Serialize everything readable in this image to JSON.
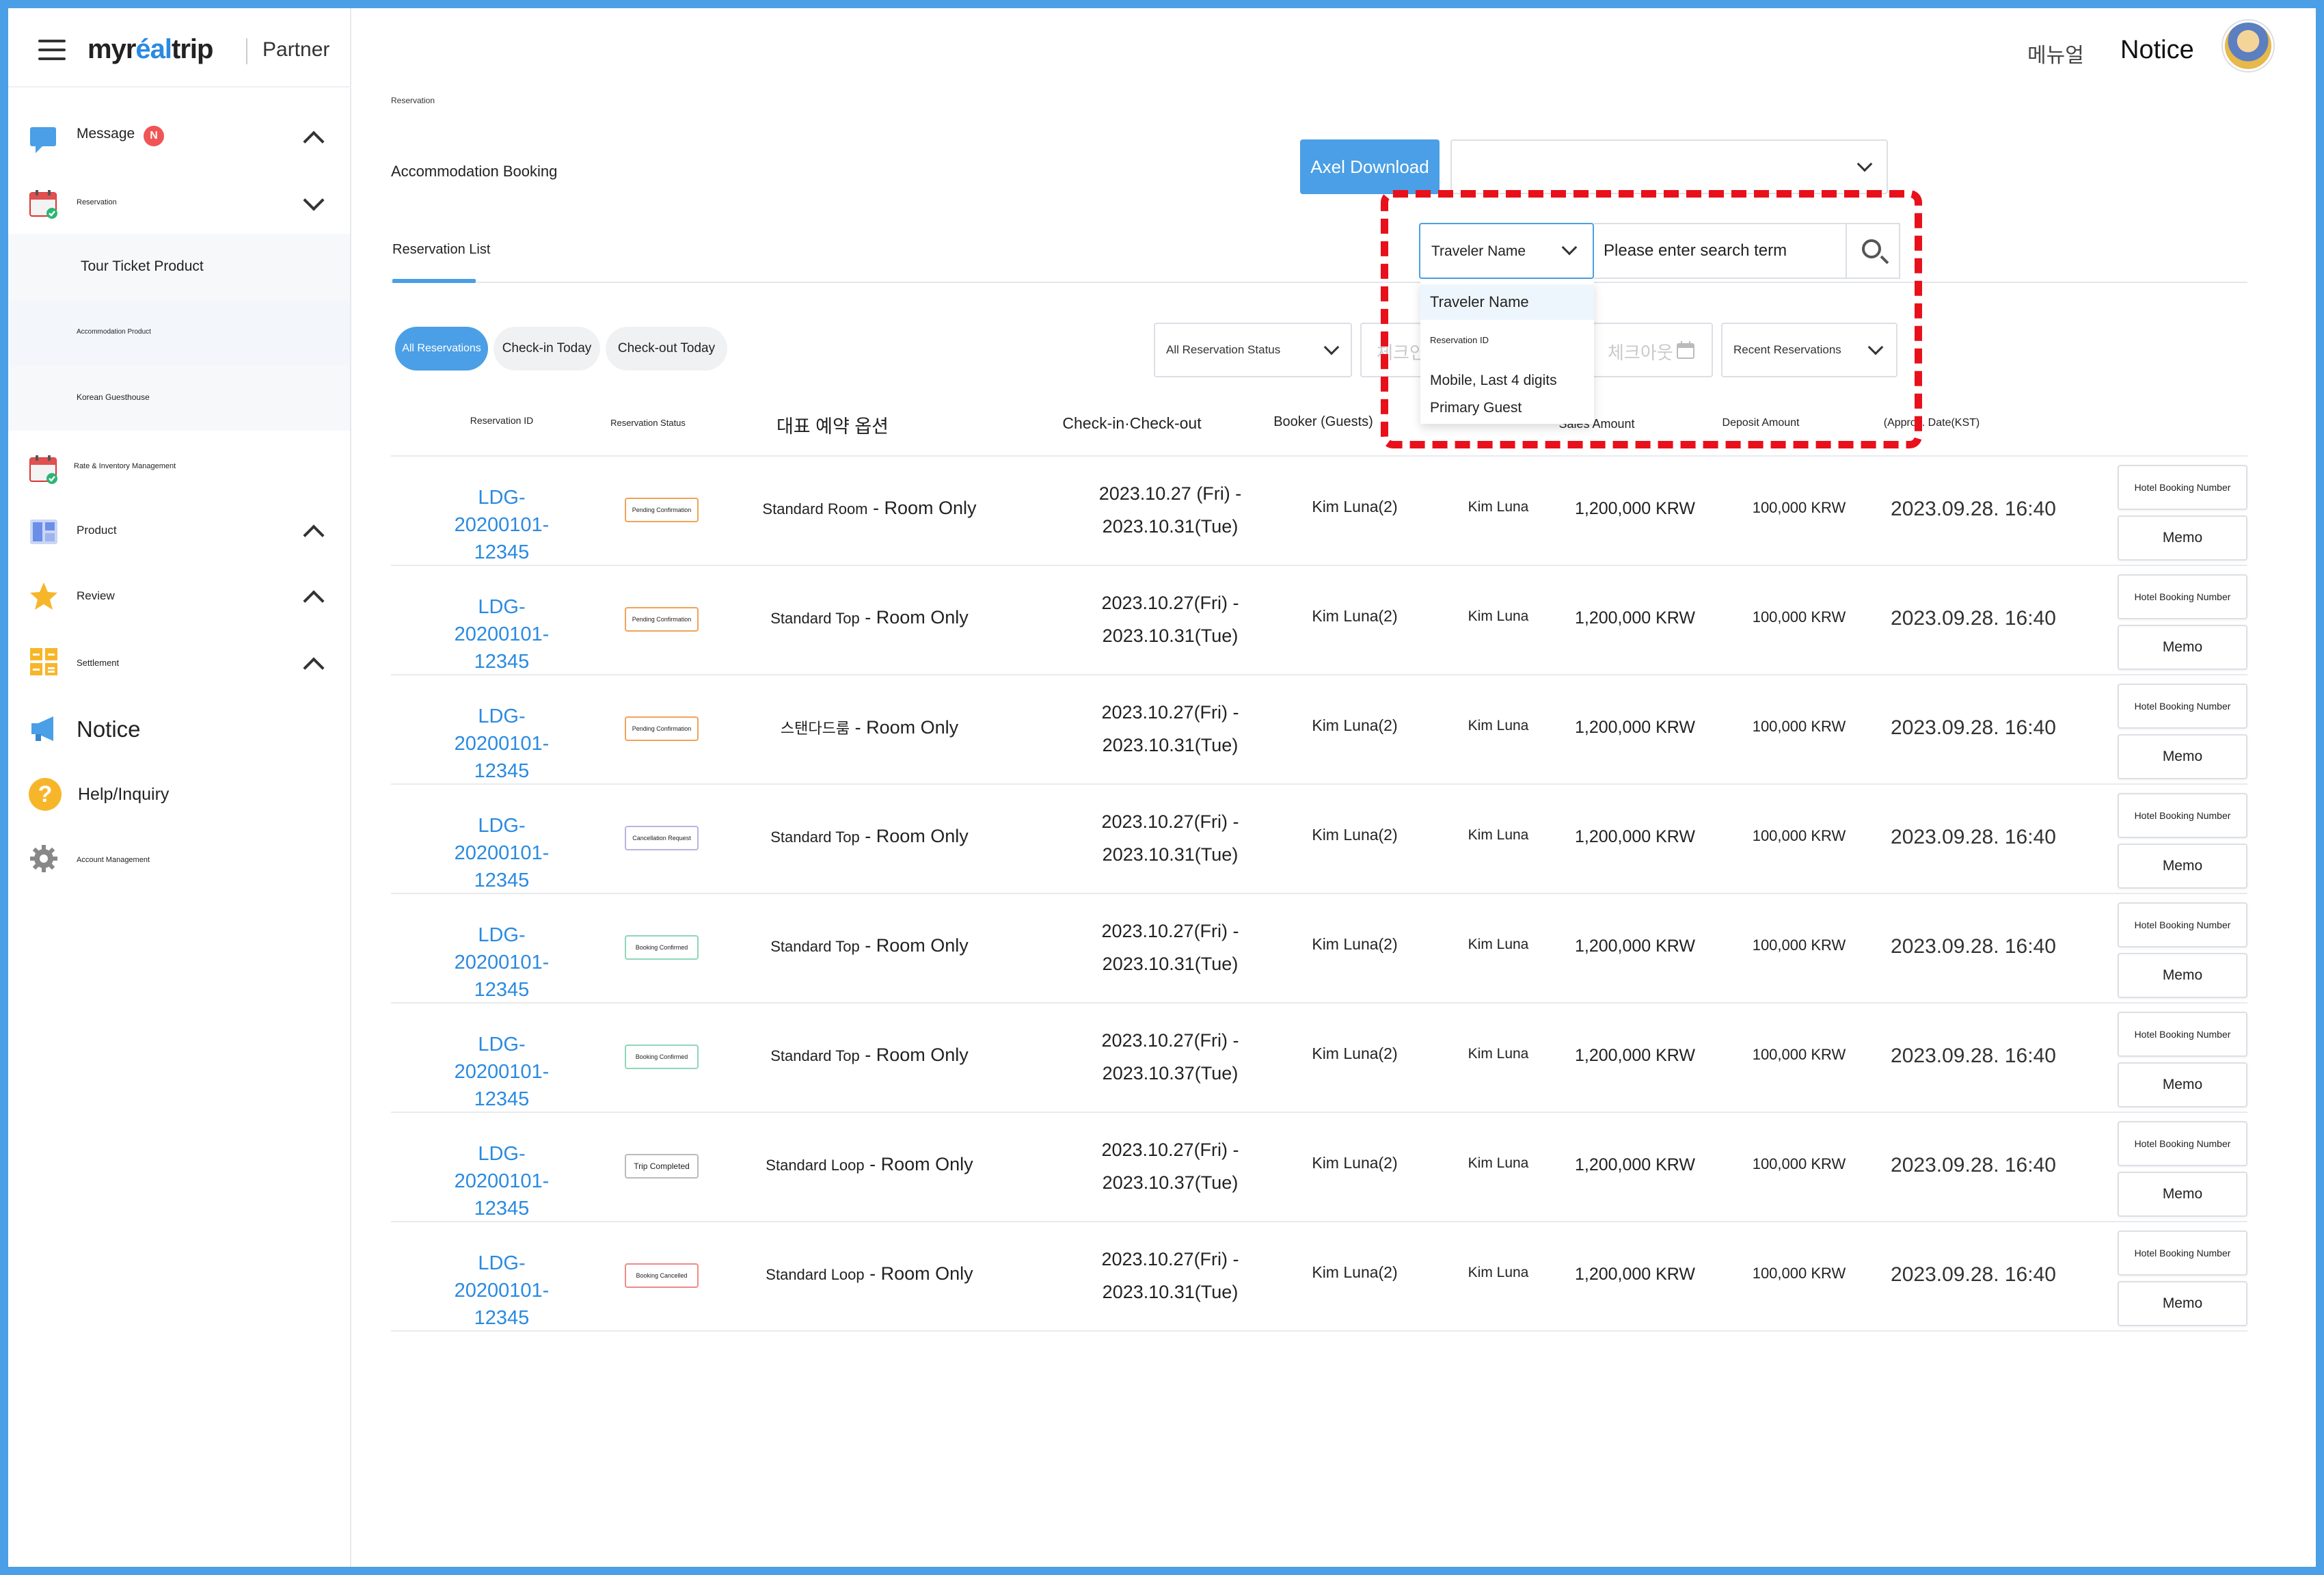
{
  "brand": {
    "logo_pre": "myr",
    "logo_accent": "éal",
    "logo_post": "trip",
    "partner": "Partner",
    "accent_color": "#4a9fe6",
    "alert_color": "#f05454",
    "highlight_color": "#e8101a"
  },
  "topnav": {
    "manual": "메뉴얼",
    "notice": "Notice"
  },
  "sidebar": {
    "message": "Message",
    "message_badge": "N",
    "reservation": "Reservation",
    "sub_tour": "Tour Ticket Product",
    "sub_accommodation": "Accommodation Product",
    "sub_guesthouse": "Korean Guesthouse",
    "rate_inventory": "Rate & Inventory Management",
    "product": "Product",
    "review": "Review",
    "settlement": "Settlement",
    "notice": "Notice",
    "help": "Help/Inquiry",
    "account": "Account Management"
  },
  "page": {
    "breadcrumb": "Reservation",
    "title": "Accommodation Booking",
    "download": "Axel Download",
    "tab": "Reservation List"
  },
  "filters": {
    "chip_all": "All Reservations",
    "chip_checkin": "Check-in Today",
    "chip_checkout": "Check-out Today",
    "status_select": "All Reservation Status",
    "checkin_placeholder": "체크인",
    "checkout_placeholder": "체크아웃",
    "sort_select": "Recent Reservations"
  },
  "search": {
    "type_selected": "Traveler Name",
    "placeholder": "Please enter search term",
    "options": [
      "Traveler Name",
      "Reservation ID",
      "Mobile, Last 4 digits",
      "Primary Guest"
    ]
  },
  "table": {
    "headers": {
      "id": "Reservation ID",
      "status": "Reservation Status",
      "option": "대표 예약 옵션",
      "dates": "Check-in·Check-out",
      "booker": "Booker (Guests)",
      "sales": "Sales Amount",
      "deposit": "Deposit Amount",
      "date_kst": "(Approx. Date(KST)"
    },
    "rows": [
      {
        "id": "LDG-20200101-12345",
        "status": "Pending Confirmation",
        "room": "Standard Room",
        "plan": "Room Only",
        "checkin": "2023.10.27 (Fri)",
        "checkout": "2023.10.31(Tue)",
        "booker": "Kim Luna(2)",
        "guest": "Kim Luna",
        "sales": "1,200,000 KRW",
        "deposit": "100,000 KRW",
        "date": "2023.09.28. 16:40",
        "hotel_btn": "Hotel Booking Number",
        "memo": "Memo"
      },
      {
        "id": "LDG-20200101-12345",
        "status": "Pending Confirmation",
        "room": "Standard Top",
        "plan": "Room Only",
        "checkin": "2023.10.27(Fri)",
        "checkout": "2023.10.31(Tue)",
        "booker": "Kim Luna(2)",
        "guest": "Kim Luna",
        "sales": "1,200,000 KRW",
        "deposit": "100,000 KRW",
        "date": "2023.09.28. 16:40",
        "hotel_btn": "Hotel Booking Number",
        "memo": "Memo"
      },
      {
        "id": "LDG-20200101-12345",
        "status": "Pending Confirmation",
        "room": "스탠다드룸",
        "plan": "Room Only",
        "checkin": "2023.10.27(Fri)",
        "checkout": "2023.10.31(Tue)",
        "booker": "Kim Luna(2)",
        "guest": "Kim Luna",
        "sales": "1,200,000 KRW",
        "deposit": "100,000 KRW",
        "date": "2023.09.28. 16:40",
        "hotel_btn": "Hotel Booking Number",
        "memo": "Memo"
      },
      {
        "id": "LDG-20200101-12345",
        "status": "Cancellation Request",
        "room": "Standard Top",
        "plan": "Room Only",
        "checkin": "2023.10.27(Fri)",
        "checkout": "2023.10.31(Tue)",
        "booker": "Kim Luna(2)",
        "guest": "Kim Luna",
        "sales": "1,200,000 KRW",
        "deposit": "100,000 KRW",
        "date": "2023.09.28. 16:40",
        "hotel_btn": "Hotel Booking Number",
        "memo": "Memo"
      },
      {
        "id": "LDG-20200101-12345",
        "status": "Booking Confirmed",
        "room": "Standard Top",
        "plan": "Room Only",
        "checkin": "2023.10.27(Fri)",
        "checkout": "2023.10.31(Tue)",
        "booker": "Kim Luna(2)",
        "guest": "Kim Luna",
        "sales": "1,200,000 KRW",
        "deposit": "100,000 KRW",
        "date": "2023.09.28. 16:40",
        "hotel_btn": "Hotel Booking Number",
        "memo": "Memo"
      },
      {
        "id": "LDG-20200101-12345",
        "status": "Booking Confirmed",
        "room": "Standard Top",
        "plan": "Room Only",
        "checkin": "2023.10.27(Fri)",
        "checkout": "2023.10.37(Tue)",
        "booker": "Kim Luna(2)",
        "guest": "Kim Luna",
        "sales": "1,200,000 KRW",
        "deposit": "100,000 KRW",
        "date": "2023.09.28. 16:40",
        "hotel_btn": "Hotel Booking Number",
        "memo": "Memo"
      },
      {
        "id": "LDG-20200101-12345",
        "status": "Trip Completed",
        "room": "Standard Loop",
        "plan": "Room Only",
        "checkin": "2023.10.27(Fri)",
        "checkout": "2023.10.37(Tue)",
        "booker": "Kim Luna(2)",
        "guest": "Kim Luna",
        "sales": "1,200,000 KRW",
        "deposit": "100,000 KRW",
        "date": "2023.09.28. 16:40",
        "hotel_btn": "Hotel Booking Number",
        "memo": "Memo"
      },
      {
        "id": "LDG-20200101-12345",
        "status": "Booking Cancelled",
        "room": "Standard Loop",
        "plan": "Room Only",
        "checkin": "2023.10.27(Fri)",
        "checkout": "2023.10.31(Tue)",
        "booker": "Kim Luna(2)",
        "guest": "Kim Luna",
        "sales": "1,200,000 KRW",
        "deposit": "100,000 KRW",
        "date": "2023.09.28. 16:40",
        "hotel_btn": "Hotel Booking Number",
        "memo": "Memo"
      }
    ]
  },
  "status_colors": {
    "Pending Confirmation": "#f0a35a",
    "Cancellation Request": "#b9b6dc",
    "Booking Confirmed": "#8fd6b8",
    "Trip Completed": "#bbbbbb",
    "Booking Cancelled": "#f08a8a"
  },
  "icons": {
    "menu": "hamburger-icon",
    "message": "chat-bubble-icon",
    "reservation": "calendar-check-icon",
    "rate": "calendar-check-icon",
    "product": "grid-icon",
    "review": "star-icon",
    "settlement": "calculator-icon",
    "notice": "megaphone-icon",
    "help": "question-icon",
    "account": "gear-icon",
    "search": "search-icon",
    "calendar": "calendar-icon"
  }
}
